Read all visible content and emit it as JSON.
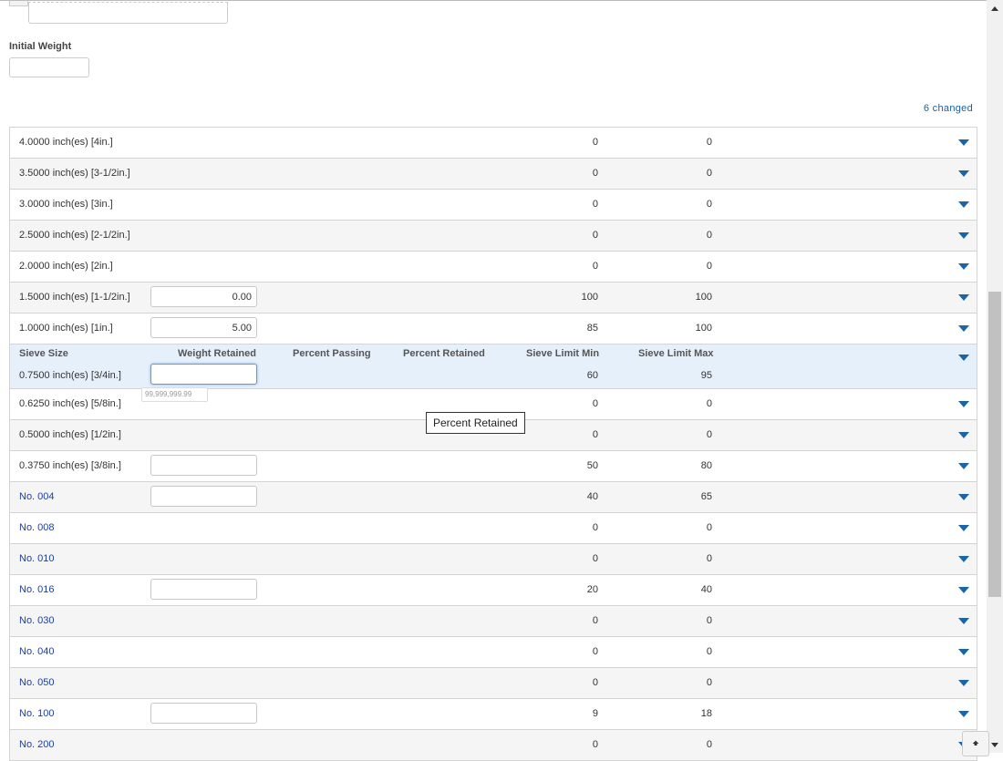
{
  "form": {
    "initial_weight_label": "Initial Weight",
    "initial_weight_value": "",
    "changed_text": "6 changed"
  },
  "columns": {
    "sieve_size": "Sieve Size",
    "weight_retained": "Weight Retained",
    "percent_passing": "Percent Passing",
    "percent_retained": "Percent Retained",
    "sieve_limit_min": "Sieve Limit Min",
    "sieve_limit_max": "Sieve Limit Max"
  },
  "rows": [
    {
      "name": "4.0000 inch(es) [4in.]",
      "min": "0",
      "max": "0"
    },
    {
      "name": "3.5000 inch(es) [3-1/2in.]",
      "min": "0",
      "max": "0"
    },
    {
      "name": "3.0000 inch(es) [3in.]",
      "min": "0",
      "max": "0"
    },
    {
      "name": "2.5000 inch(es) [2-1/2in.]",
      "min": "0",
      "max": "0"
    },
    {
      "name": "2.0000 inch(es) [2in.]",
      "min": "0",
      "max": "0"
    },
    {
      "name": "1.5000 inch(es) [1-1/2in.]",
      "weight": "0.00",
      "min": "100",
      "max": "100"
    },
    {
      "name": "1.0000 inch(es) [1in.]",
      "weight": "5.00",
      "min": "85",
      "max": "100"
    },
    {
      "name": "0.7500 inch(es) [3/4in.]",
      "weight": "",
      "min": "60",
      "max": "95"
    },
    {
      "name": "0.6250 inch(es) [5/8in.]",
      "min": "0",
      "max": "0"
    },
    {
      "name": "0.5000 inch(es) [1/2in.]",
      "min": "0",
      "max": "0"
    },
    {
      "name": "0.3750 inch(es) [3/8in.]",
      "weight": "",
      "min": "50",
      "max": "80"
    },
    {
      "name": "No. 004",
      "weight": "",
      "min": "40",
      "max": "65"
    },
    {
      "name": "No. 008",
      "min": "0",
      "max": "0"
    },
    {
      "name": "No. 010",
      "min": "0",
      "max": "0"
    },
    {
      "name": "No. 016",
      "weight": "",
      "min": "20",
      "max": "40"
    },
    {
      "name": "No. 030",
      "min": "0",
      "max": "0"
    },
    {
      "name": "No. 040",
      "min": "0",
      "max": "0"
    },
    {
      "name": "No. 050",
      "min": "0",
      "max": "0"
    },
    {
      "name": "No. 100",
      "weight": "",
      "min": "9",
      "max": "18"
    },
    {
      "name": "No. 200",
      "min": "0",
      "max": "0"
    }
  ],
  "mask_hint": "99,999,999.99",
  "tooltip": "Percent Retained",
  "icons": {
    "expand": "chevron-down-icon",
    "back_to_top": "arrow-up-icon"
  },
  "colors": {
    "link_blue": "#1a3ea8",
    "chevron": "#1a65a8",
    "expanded_bg": "#e6f0fa"
  }
}
